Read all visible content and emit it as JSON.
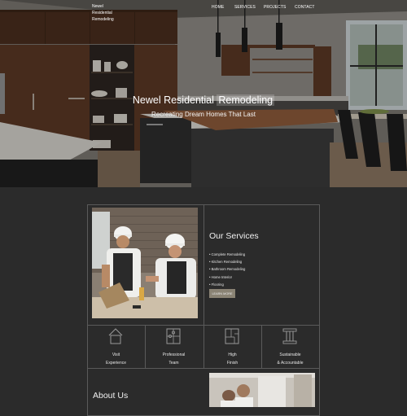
{
  "brand": {
    "line1": "Newel",
    "line2": "Residential",
    "line3": "Remodeling"
  },
  "nav": [
    "HOME",
    "SERVICES",
    "PROJECTS",
    "CONTACT"
  ],
  "hero": {
    "title_main": "Newel Residential",
    "title_highlight": "Remodeling",
    "subtitle": "Recreating Dream Homes That Last"
  },
  "services": {
    "title": "Our Services",
    "items": [
      "Complete Remodeling",
      "Kitchen Remodeling",
      "Bathroom Remodeling",
      "Home Interior",
      "Flooring"
    ],
    "button_label": "LEARN MORE"
  },
  "features": [
    {
      "icon": "house-icon",
      "line1": "Visit",
      "line2": "Experience"
    },
    {
      "icon": "puzzle-icon",
      "line1": "Professional",
      "line2": "Team"
    },
    {
      "icon": "floorplan-icon",
      "line1": "High",
      "line2": "Finish"
    },
    {
      "icon": "pillars-icon",
      "line1": "Sustainable",
      "line2": "& Accountable"
    }
  ],
  "about": {
    "title": "About Us"
  },
  "colors": {
    "background": "#2b2b2b",
    "border": "#5a5a5a",
    "button": "#8a8374"
  }
}
